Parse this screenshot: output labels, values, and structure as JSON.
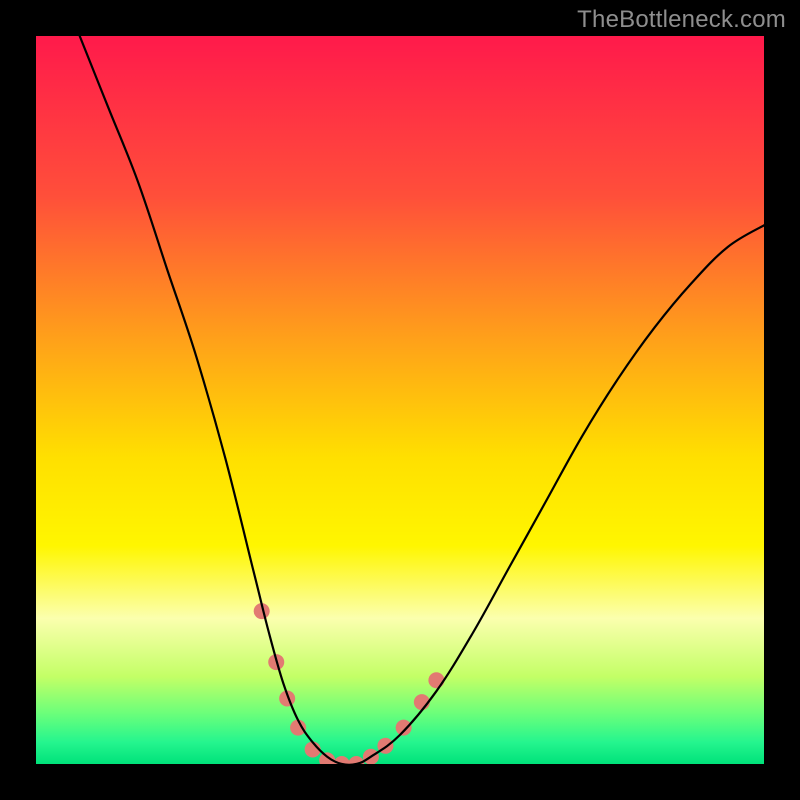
{
  "watermark": "TheBottleneck.com",
  "chart_data": {
    "type": "line",
    "title": "",
    "xlabel": "",
    "ylabel": "",
    "xlim": [
      0,
      100
    ],
    "ylim": [
      0,
      100
    ],
    "grid": false,
    "legend": false,
    "background_gradient": {
      "stops": [
        {
          "offset": 0.0,
          "color": "#ff1a4b"
        },
        {
          "offset": 0.22,
          "color": "#ff4f3a"
        },
        {
          "offset": 0.42,
          "color": "#ffa219"
        },
        {
          "offset": 0.58,
          "color": "#ffe000"
        },
        {
          "offset": 0.7,
          "color": "#fff600"
        },
        {
          "offset": 0.8,
          "color": "#fbffae"
        },
        {
          "offset": 0.88,
          "color": "#c3ff66"
        },
        {
          "offset": 0.93,
          "color": "#6cff7a"
        },
        {
          "offset": 0.97,
          "color": "#25f58e"
        },
        {
          "offset": 1.0,
          "color": "#00e27a"
        }
      ]
    },
    "series": [
      {
        "name": "bottleneck-curve",
        "color": "#000000",
        "thickness": 2.2,
        "x": [
          6,
          10,
          14,
          18,
          22,
          26,
          30,
          32,
          34,
          36,
          38,
          40,
          42,
          44,
          46,
          50,
          55,
          60,
          65,
          70,
          75,
          80,
          85,
          90,
          95,
          100
        ],
        "y": [
          100,
          90,
          80,
          68,
          56,
          42,
          26,
          18,
          11,
          6,
          3,
          1,
          0,
          0,
          1,
          4,
          10,
          18,
          27,
          36,
          45,
          53,
          60,
          66,
          71,
          74
        ]
      }
    ],
    "markers": {
      "name": "highlight-dots",
      "color": "#e27a72",
      "radius": 8,
      "points": [
        {
          "x": 31,
          "y": 21
        },
        {
          "x": 33,
          "y": 14
        },
        {
          "x": 34.5,
          "y": 9
        },
        {
          "x": 36,
          "y": 5
        },
        {
          "x": 38,
          "y": 2
        },
        {
          "x": 40,
          "y": 0.5
        },
        {
          "x": 42,
          "y": 0
        },
        {
          "x": 44,
          "y": 0
        },
        {
          "x": 46,
          "y": 1
        },
        {
          "x": 48,
          "y": 2.5
        },
        {
          "x": 50.5,
          "y": 5
        },
        {
          "x": 53,
          "y": 8.5
        },
        {
          "x": 55,
          "y": 11.5
        }
      ]
    }
  }
}
